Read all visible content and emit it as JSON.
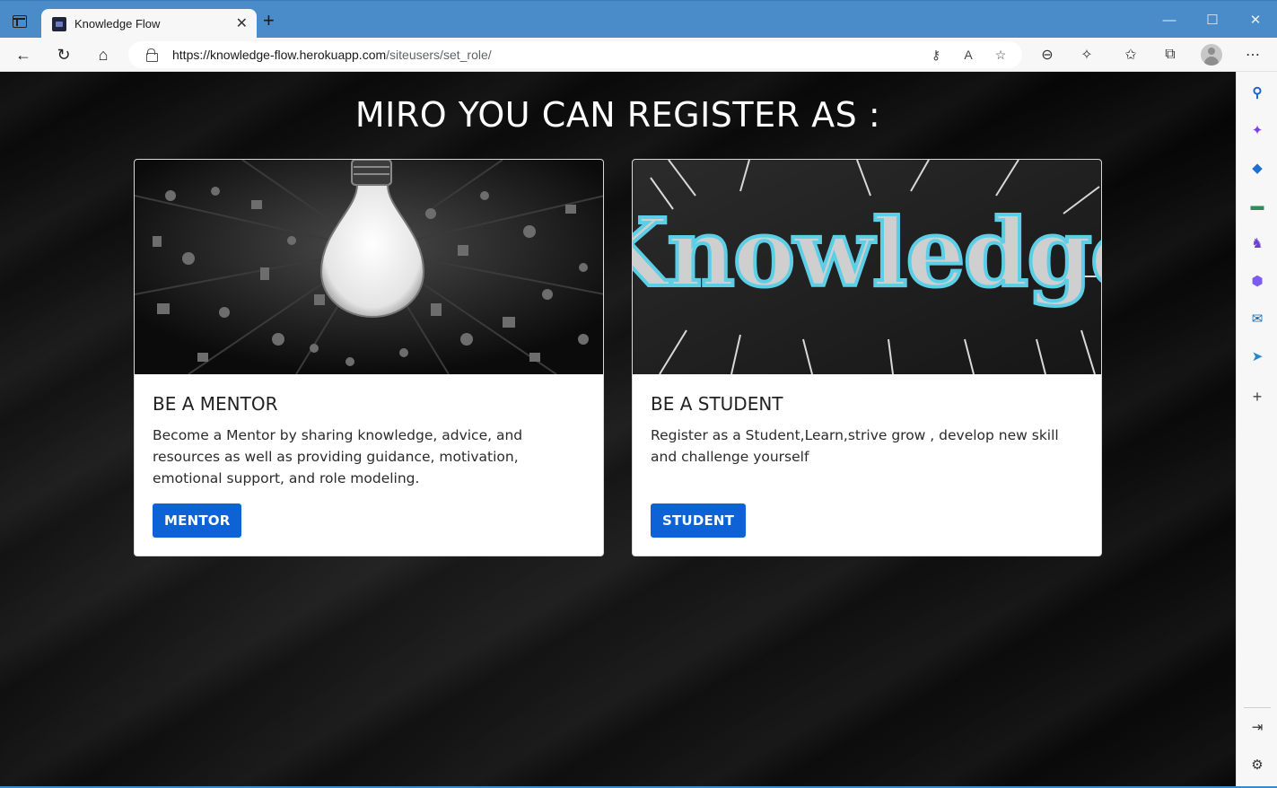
{
  "browser": {
    "tab_title": "Knowledge Flow",
    "tab_close": "✕",
    "new_tab": "+",
    "url_host": "https://knowledge-flow.herokuapp.com",
    "url_path": "/siteusers/set_role/"
  },
  "page": {
    "title": "MIRO YOU CAN REGISTER AS :",
    "cards": [
      {
        "title": "BE A MENTOR",
        "text": "Become a Mentor by sharing knowledge, advice, and resources as well as providing guidance, motivation, emotional support, and role modeling.",
        "button": "MENTOR"
      },
      {
        "title": "BE A STUDENT",
        "text": "Register as a Student,Learn,strive grow , develop new skill and challenge yourself",
        "button": "STUDENT",
        "image_word": "Knowledge"
      }
    ]
  },
  "colors": {
    "accent_button": "#0d63d6",
    "titlebar": "#4a8cc9",
    "page_background": "#0c0c0c"
  },
  "icons": {
    "sidebar": [
      "search-icon",
      "copilot-icon",
      "shopping-tag-icon",
      "tools-icon",
      "games-icon",
      "m365-icon",
      "outlook-icon",
      "send-icon",
      "add-icon",
      "sidebar-toggle-icon",
      "settings-icon"
    ]
  }
}
